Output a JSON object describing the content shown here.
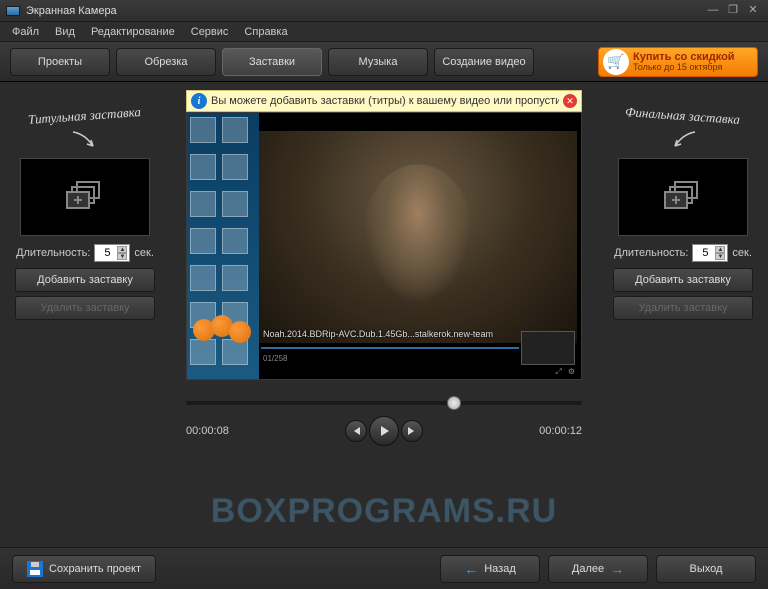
{
  "window": {
    "title": "Экранная Камера"
  },
  "menu": {
    "file": "Файл",
    "view": "Вид",
    "edit": "Редактирование",
    "service": "Сервис",
    "help": "Справка"
  },
  "tabs": {
    "projects": "Проекты",
    "trim": "Обрезка",
    "intros": "Заставки",
    "music": "Музыка",
    "create": "Создание видео"
  },
  "promo": {
    "line1": "Купить со скидкой",
    "line2": "Только до 15 октября"
  },
  "info": {
    "text": "Вы можете добавить заставки (титры) к вашему видео или пропустить этот ш"
  },
  "left": {
    "title": "Титульная заставка",
    "dur_label": "Длительность:",
    "dur_val": "5",
    "dur_unit": "сек.",
    "add": "Добавить заставку",
    "del": "Удалить заставку"
  },
  "right": {
    "title": "Финальная заставка",
    "dur_label": "Длительность:",
    "dur_val": "5",
    "dur_unit": "сек.",
    "add": "Добавить заставку",
    "del": "Удалить заставку"
  },
  "video": {
    "filename": "Noah.2014.BDRip-AVC.Dub.1.45Gb...stalkerok.new-team",
    "inner_time": "01/258"
  },
  "timeline": {
    "pos": "00:00:08",
    "total": "00:00:12"
  },
  "footer": {
    "save": "Сохранить проект",
    "back": "Назад",
    "next": "Далее",
    "exit": "Выход"
  },
  "watermark": "BOXPROGRAMS.RU"
}
